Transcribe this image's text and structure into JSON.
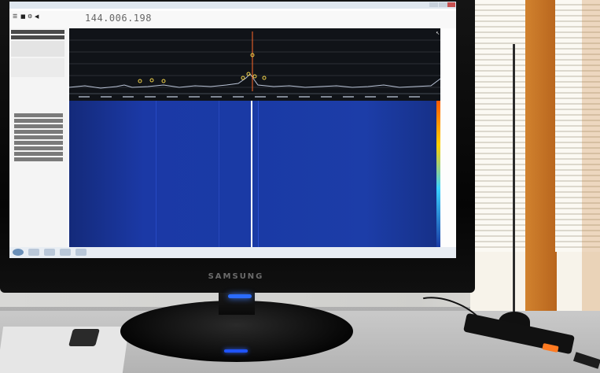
{
  "scene": {
    "monitor_brand": "SAMSUNG",
    "colors": {
      "fft_background": "#101318",
      "waterfall_blue": "#1a3aa5",
      "center_line": "#ffffff",
      "window_frame": "#c27224",
      "power_led": "#2b6cff",
      "dongle_led": "#ff7a21"
    }
  },
  "app": {
    "frequency_display": "144.006.198",
    "toolbar_icons": [
      "menu-icon",
      "stop-icon",
      "settings-icon",
      "volume-icon"
    ],
    "fft_spectrum": true,
    "waterfall": true
  }
}
